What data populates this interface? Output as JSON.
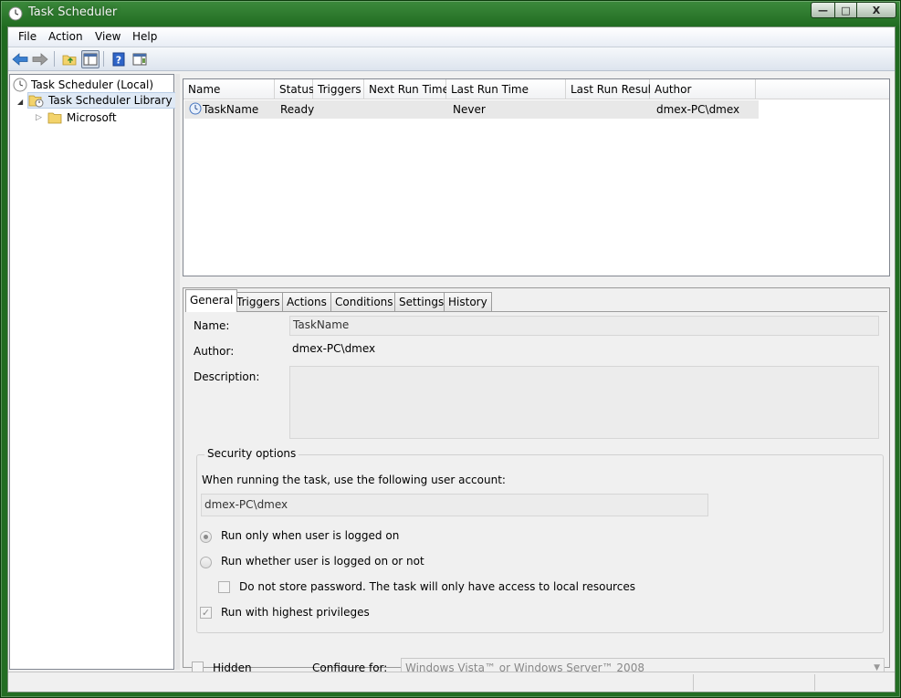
{
  "window": {
    "title": "Task Scheduler",
    "min_label": "—",
    "max_label": "□",
    "close_label": "X"
  },
  "menu": {
    "items": [
      "File",
      "Action",
      "View",
      "Help"
    ]
  },
  "toolbar": {
    "icons": [
      "back-icon",
      "forward-icon",
      "up-folder-icon",
      "show-hide-console-tree-icon",
      "help-icon",
      "show-hide-action-pane-icon"
    ]
  },
  "tree": {
    "root": "Task Scheduler (Local)",
    "library": "Task Scheduler Library",
    "microsoft": "Microsoft"
  },
  "task_list": {
    "columns": [
      "Name",
      "Status",
      "Triggers",
      "Next Run Time",
      "Last Run Time",
      "Last Run Result",
      "Author"
    ],
    "rows": [
      {
        "name": "TaskName",
        "status": "Ready",
        "triggers": "",
        "next_run": "",
        "last_run": "Never",
        "last_result": "",
        "author": "dmex-PC\\dmex"
      }
    ]
  },
  "tabs": [
    "General",
    "Triggers",
    "Actions",
    "Conditions",
    "Settings",
    "History"
  ],
  "general": {
    "name_label": "Name:",
    "name_value": "TaskName",
    "author_label": "Author:",
    "author_value": "dmex-PC\\dmex",
    "description_label": "Description:",
    "description_value": "",
    "security_title": "Security options",
    "account_prompt": "When running the task, use the following user account:",
    "account_value": "dmex-PC\\dmex",
    "radio_logged_on": "Run only when user is logged on",
    "radio_whether": "Run whether user is logged on or not",
    "no_store_password": "Do not store password.  The task will only have access to local resources",
    "highest_privileges": "Run with highest privileges",
    "hidden_label": "Hidden",
    "configure_label": "Configure for:",
    "configure_value": "Windows Vista™ or Windows Server™ 2008"
  }
}
